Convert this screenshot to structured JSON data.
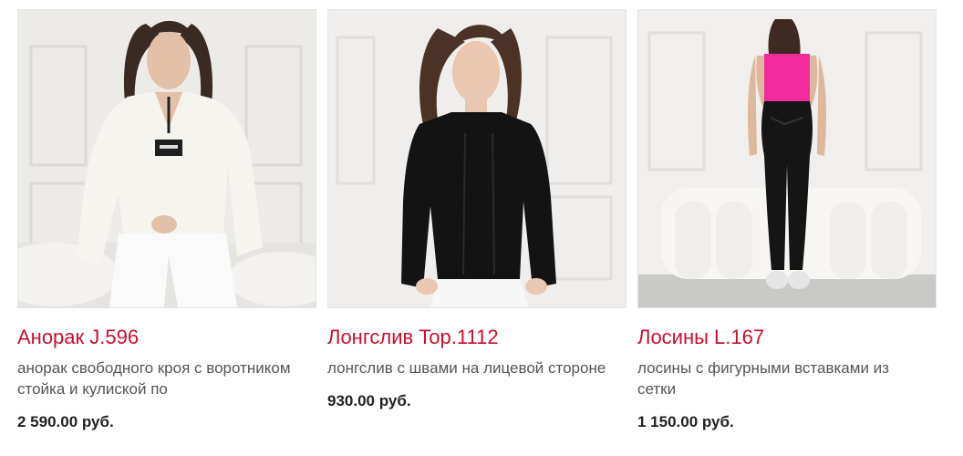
{
  "products": [
    {
      "title": "Анорак J.596",
      "description": "анорак свободного кроя с воротником стойка и кулиской по",
      "price": "2 590.00 руб.",
      "image": "woman-in-white-anorak-photo"
    },
    {
      "title": "Лонгслив Top.1112",
      "description": "лонгслив с швами на лицевой стороне",
      "price": "930.00 руб.",
      "image": "woman-in-black-longsleeve-photo"
    },
    {
      "title": "Лосины L.167",
      "description": "лосины с фигурными вставками из сетки",
      "price": "1 150.00 руб.",
      "image": "woman-in-black-leggings-photo"
    }
  ],
  "colors": {
    "title": "#c8102e",
    "description": "#555555",
    "price": "#222222"
  }
}
